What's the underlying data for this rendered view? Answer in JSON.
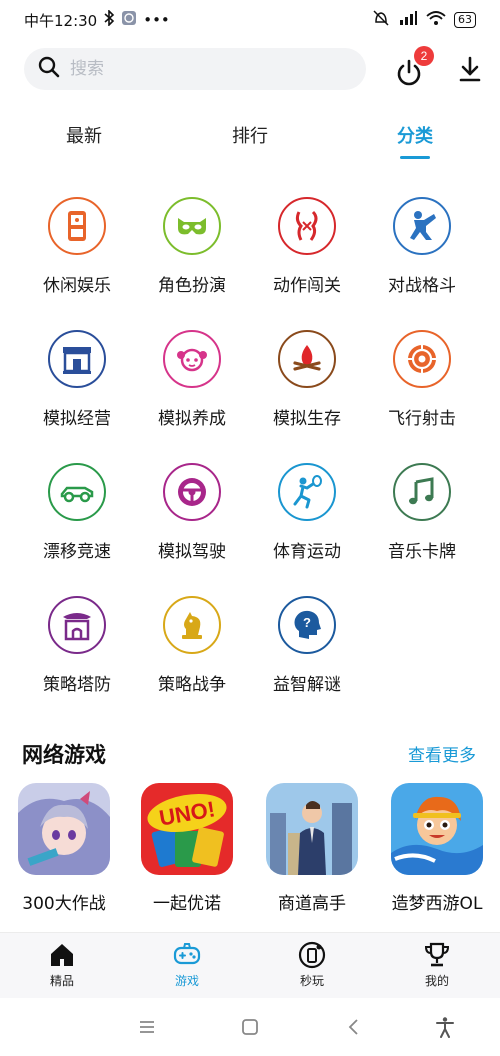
{
  "status_bar": {
    "time": "中午12:30",
    "battery": "63"
  },
  "search": {
    "placeholder": "搜索",
    "notification_count": "2"
  },
  "tabs": [
    {
      "label": "最新",
      "active": false
    },
    {
      "label": "排行",
      "active": false
    },
    {
      "label": "分类",
      "active": true
    }
  ],
  "categories": [
    {
      "label": "休闲娱乐",
      "icon": "handheld-console-icon",
      "color": "#e8642a"
    },
    {
      "label": "角色扮演",
      "icon": "mask-icon",
      "color": "#7cbd2c"
    },
    {
      "label": "动作闯关",
      "icon": "fighter-icon",
      "color": "#d6282c"
    },
    {
      "label": "对战格斗",
      "icon": "kick-fighter-icon",
      "color": "#2b72c0"
    },
    {
      "label": "模拟经营",
      "icon": "shop-icon",
      "color": "#2a4e9a"
    },
    {
      "label": "模拟养成",
      "icon": "girl-face-icon",
      "color": "#d6348a"
    },
    {
      "label": "模拟生存",
      "icon": "campfire-icon",
      "color": "#8a4a1c"
    },
    {
      "label": "飞行射击",
      "icon": "target-icon",
      "color": "#e8642a"
    },
    {
      "label": "漂移竞速",
      "icon": "race-car-icon",
      "color": "#2a9a4a"
    },
    {
      "label": "模拟驾驶",
      "icon": "steering-wheel-icon",
      "color": "#a8268a"
    },
    {
      "label": "体育运动",
      "icon": "tennis-player-icon",
      "color": "#1a96d0"
    },
    {
      "label": "音乐卡牌",
      "icon": "music-note-icon",
      "color": "#3d7a52"
    },
    {
      "label": "策略塔防",
      "icon": "castle-icon",
      "color": "#7a2a8a"
    },
    {
      "label": "策略战争",
      "icon": "chess-knight-icon",
      "color": "#d8a818"
    },
    {
      "label": "益智解谜",
      "icon": "question-head-icon",
      "color": "#1c5a9e"
    }
  ],
  "network_games": {
    "title": "网络游戏",
    "more_label": "查看更多",
    "games": [
      {
        "name": "300大作战"
      },
      {
        "name": "一起优诺",
        "logo_text": "UNO!"
      },
      {
        "name": "商道高手"
      },
      {
        "name": "造梦西游OL"
      }
    ]
  },
  "bottom_nav": [
    {
      "label": "精品",
      "icon": "home-icon",
      "active": false
    },
    {
      "label": "游戏",
      "icon": "gamepad-icon",
      "active": true
    },
    {
      "label": "秒玩",
      "icon": "instant-play-icon",
      "active": false
    },
    {
      "label": "我的",
      "icon": "trophy-icon",
      "active": false
    }
  ],
  "colors": {
    "accent": "#1a9ad6",
    "badge": "#ee3b3b"
  }
}
